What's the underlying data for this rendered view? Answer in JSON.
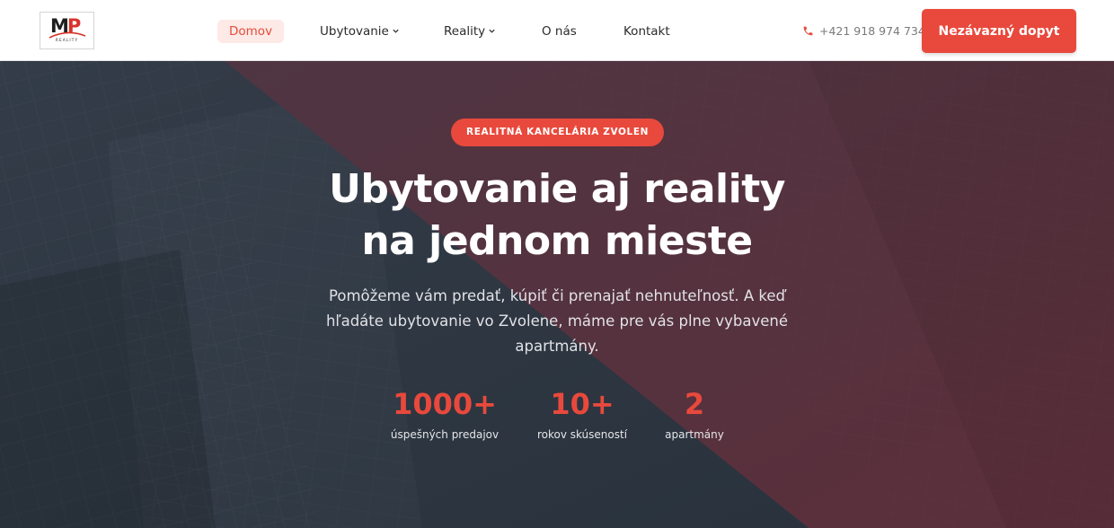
{
  "header": {
    "logo": {
      "letters_m": "M",
      "letters_p": "P",
      "sub": "REALITY"
    },
    "nav": {
      "home": "Domov",
      "accommodation": "Ubytovanie",
      "reality": "Reality",
      "about": "O nás",
      "contact": "Kontakt"
    },
    "phone": "+421 918 974 734",
    "cta": "Nezávazný dopyt"
  },
  "hero": {
    "badge": "REALITNÁ KANCELÁRIA ZVOLEN",
    "title_line1": "Ubytovanie aj reality",
    "title_line2": "na jednom mieste",
    "subtitle": "Pomôžeme vám predať, kúpiť či prenajať nehnuteľnosť. A keď hľadáte ubytovanie vo Zvolene, máme pre vás plne vybavené apartmány.",
    "stats": [
      {
        "value": "1000+",
        "label": "úspešných predajov"
      },
      {
        "value": "10+",
        "label": "rokov skúseností"
      },
      {
        "value": "2",
        "label": "apartmány"
      }
    ]
  },
  "colors": {
    "accent": "#e8493c",
    "accent_light": "#fde9e6",
    "overlay_dark": "#2f3843",
    "overlay_wine": "#5a3340"
  }
}
